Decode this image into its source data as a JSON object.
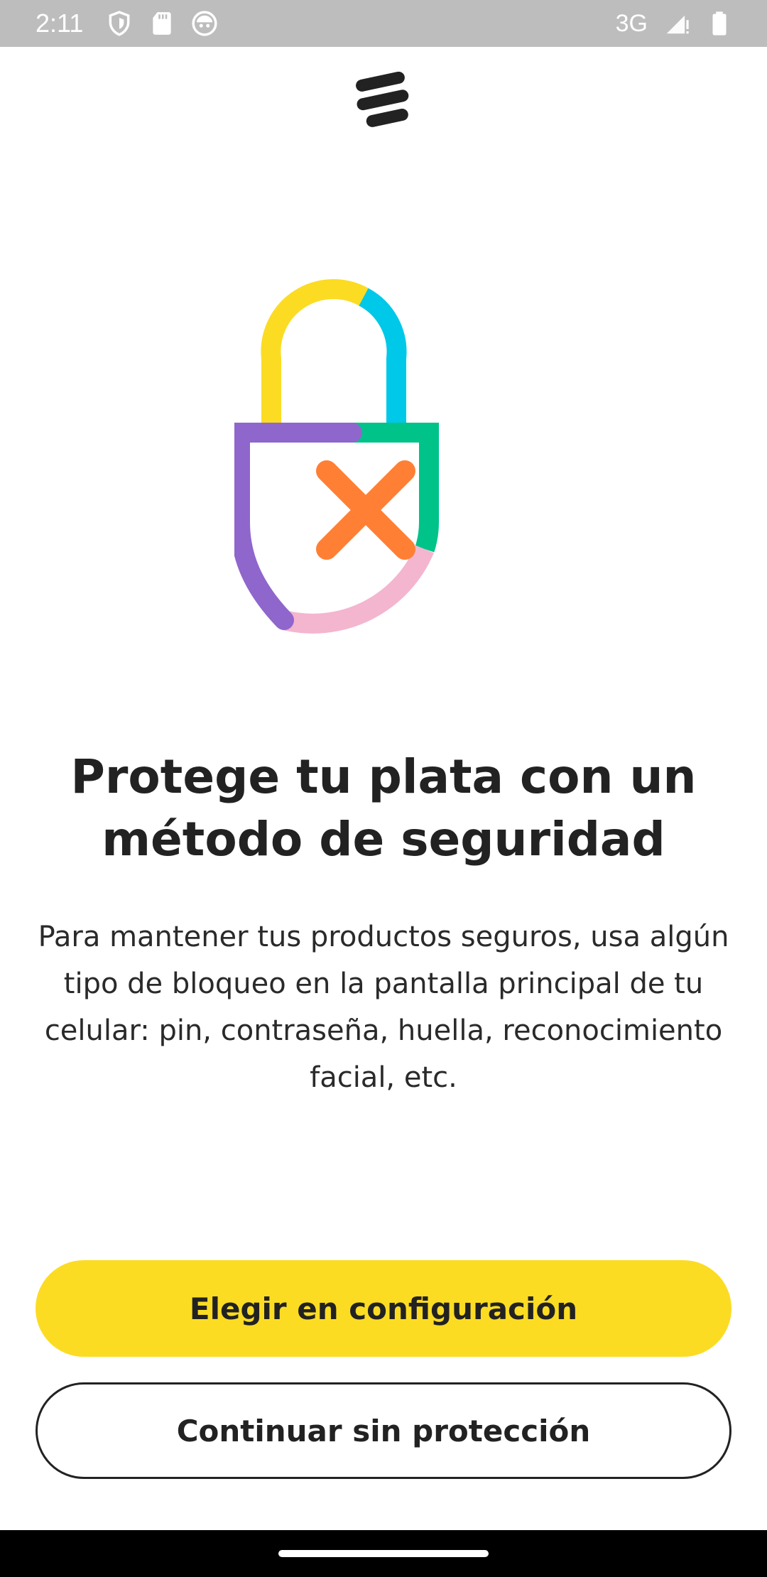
{
  "status_bar": {
    "time": "2:11",
    "network": "3G",
    "icons": [
      "shield-icon",
      "sd-card-icon",
      "robot-icon",
      "signal-icon",
      "battery-icon"
    ]
  },
  "brand": {
    "logo_icon": "stacked-bars-logo"
  },
  "illustration": {
    "icon": "padlock-with-x",
    "colors": {
      "yellow": "#fbdc23",
      "cyan": "#00c8e8",
      "purple": "#8f66cc",
      "green": "#00c389",
      "pink": "#f4b5cf",
      "orange": "#ff7f35"
    }
  },
  "content": {
    "title": "Protege tu plata con un método de seguridad",
    "description": "Para mantener tus productos seguros, usa algún tipo de bloqueo en la pantalla principal de tu celular: pin, contraseña, huella, reconocimiento facial, etc."
  },
  "actions": {
    "primary_label": "Elegir en configuración",
    "secondary_label": "Continuar sin protección"
  },
  "theme": {
    "accent": "#fbdc23",
    "text": "#222222",
    "status_bar": "#bdbdbd"
  }
}
